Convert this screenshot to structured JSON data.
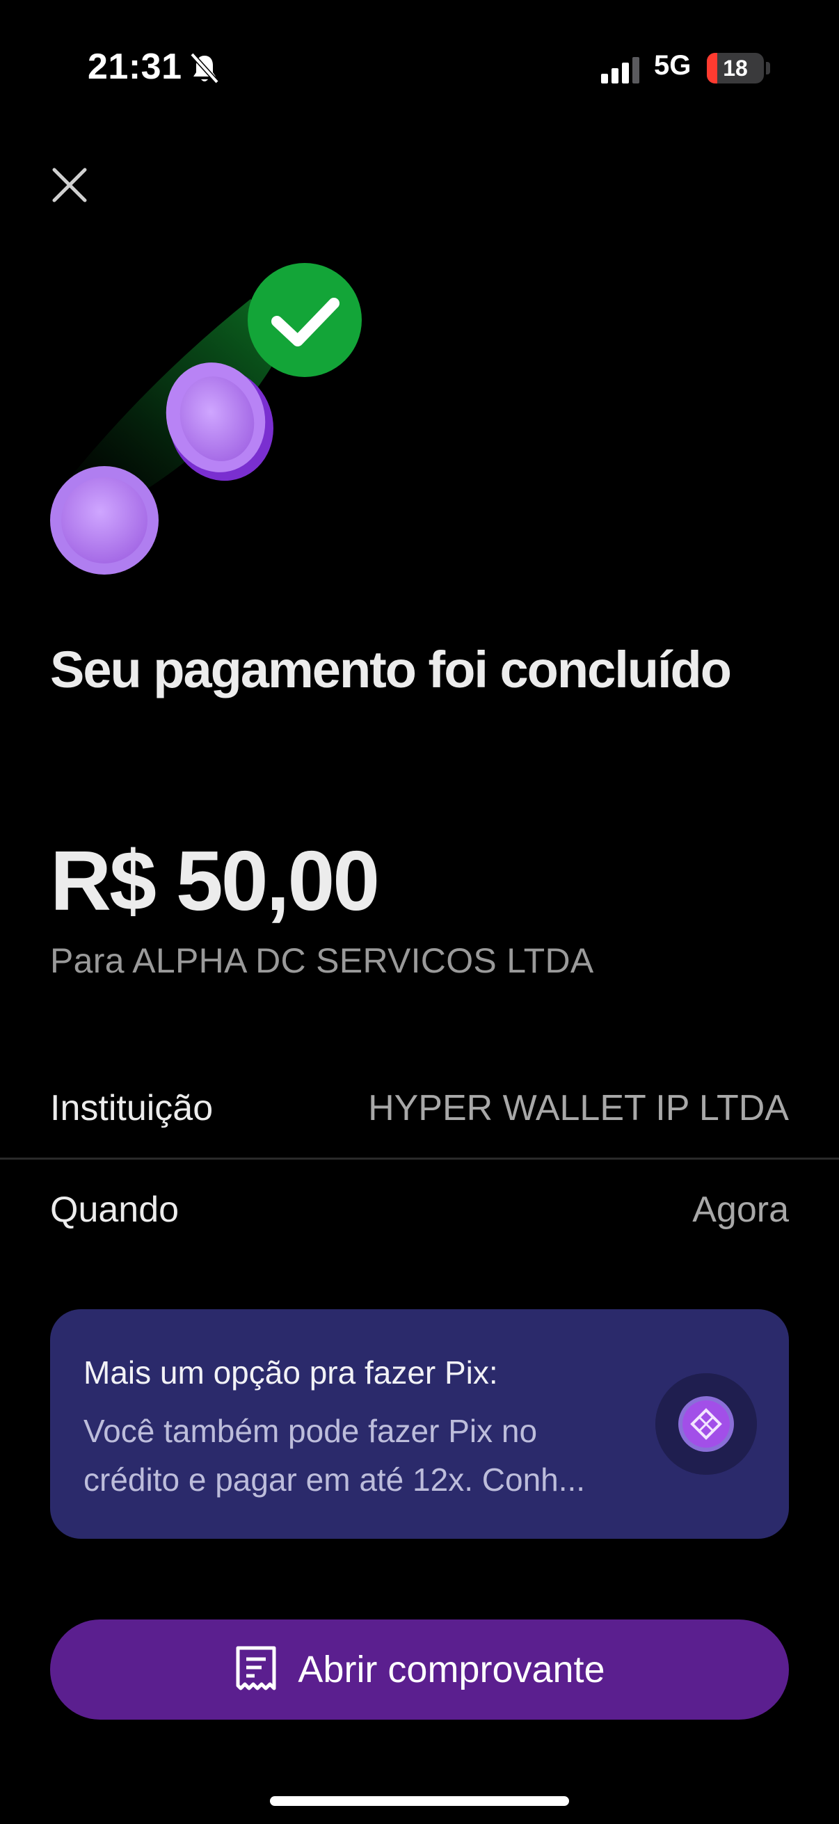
{
  "status_bar": {
    "time": "21:31",
    "network": "5G",
    "battery_level": "18",
    "battery_percent": 18,
    "battery_color": "#ff3b30"
  },
  "header": {
    "close_icon": "close-icon"
  },
  "illustration": {
    "check_color": "#13a538",
    "coin_color": "#a86be8"
  },
  "main": {
    "title": "Seu pagamento foi concluído",
    "amount": "R$ 50,00",
    "recipient": "Para ALPHA DC SERVICOS LTDA"
  },
  "details": [
    {
      "label": "Instituição",
      "value": "HYPER WALLET IP LTDA"
    },
    {
      "label": "Quando",
      "value": "Agora"
    }
  ],
  "promo": {
    "title": "Mais um opção pra fazer Pix:",
    "body": "Você também pode fazer Pix no crédito e pagar em até 12x. Conh...",
    "icon": "pix-credit-icon",
    "background": "#2b2a6b"
  },
  "actions": {
    "receipt_label": "Abrir comprovante",
    "receipt_icon": "receipt-icon",
    "button_color": "#5b1f8f"
  }
}
